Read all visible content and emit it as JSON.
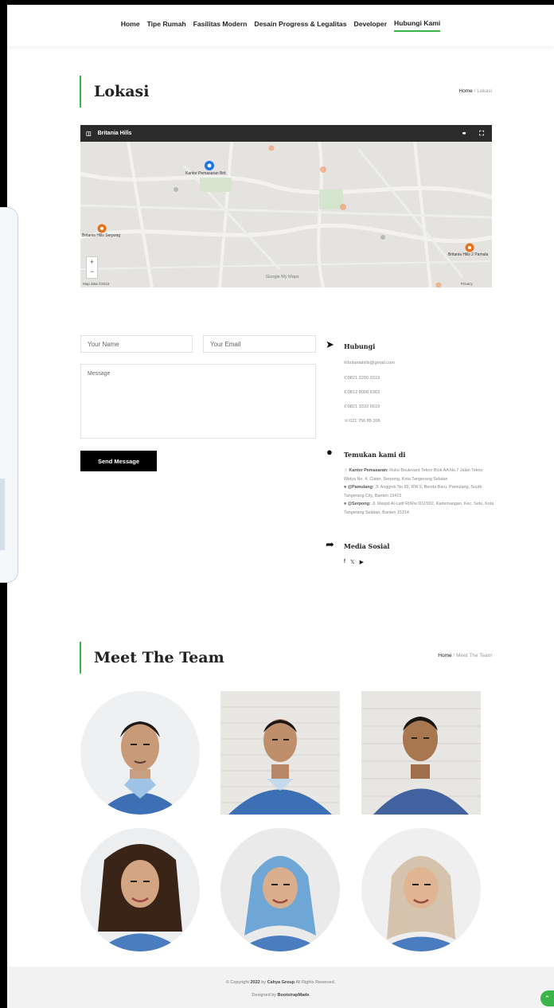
{
  "nav": {
    "items": [
      {
        "label": "Home"
      },
      {
        "label": "Tipe Rumah"
      },
      {
        "label": "Fasilitas Modern"
      },
      {
        "label": "Desain Progress & Legalitas"
      },
      {
        "label": "Developer"
      },
      {
        "label": "Hubungi Kami"
      }
    ]
  },
  "lokasi": {
    "title": "Lokasi",
    "breadcrumb": {
      "home": "Home",
      "sep": "/",
      "current": "Lokasi"
    }
  },
  "map": {
    "title": "Britania Hills",
    "labels": {
      "office": "Kantor Pemasaran Brit",
      "serpong": "Britania Hills Serpong",
      "pamulang": "Britania Hills 2 Pamula"
    },
    "google": "Google My Maps",
    "footer_left": "Map data ©2023",
    "footer_right": "Privacy",
    "zoom_in": "+",
    "zoom_out": "−"
  },
  "form": {
    "name_placeholder": "Your Name",
    "email_placeholder": "Your Email",
    "message_placeholder": "Message",
    "send_label": "Send Message"
  },
  "contact": {
    "hubungi_heading": "Hubungi",
    "email": "britaniahills@gmail.com",
    "phones": [
      "0821 2200 0319",
      "0812 8008 6363",
      "0821 3333 6619",
      "021 756 85 306"
    ],
    "temukan_heading": "Temukan kami di",
    "address_office_label": "Kantor Pemasaran:",
    "address_office": " Ruko Boulevard Tekno Blok AA No.7 Jalan Tekno Widya No. 4, Ciater, Serpong, Kota Tangerang Selatan",
    "address_pamulang_label": "@Pamulang:",
    "address_pamulang": " Jl. Anggrek No.65, RW.9, Benda Baru, Pamulang, South Tangerang City, Banten 15415",
    "address_serpong_label": "@Serpong:",
    "address_serpong": " Jl. Masjid Al-Latif Rt/Rw 002/002, Kademangan, Kec. Setu, Kota Tangerang Selatan, Banten 15314",
    "social_heading": "Media Sosial"
  },
  "team": {
    "title": "Meet The Team",
    "breadcrumb": {
      "home": "Home",
      "sep": "/",
      "current": "Meet The Team"
    }
  },
  "footer": {
    "copyright_pre": "© Copyright ",
    "copyright_year": "2022",
    "copyright_by": " by ",
    "copyright_brand": "Cahya Group",
    "copyright_post": " All Rights Reserved.",
    "designed_pre": "Designed by ",
    "designed_brand": "BootstrapMade"
  },
  "colors": {
    "accent": "#39b54a",
    "dark": "#000000",
    "map_bar": "#2b2b2b"
  }
}
